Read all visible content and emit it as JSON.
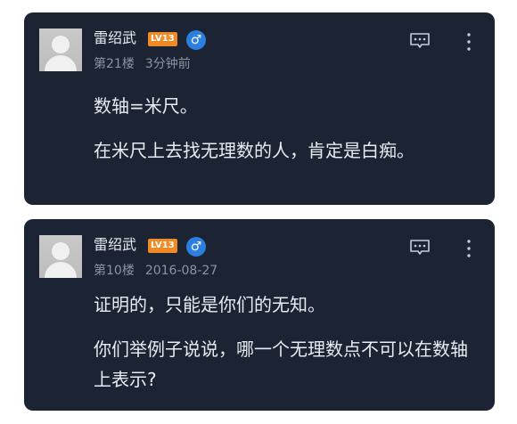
{
  "comments": [
    {
      "username": "雷绍武",
      "level": "LV13",
      "gender": "♂",
      "floor": "第21楼",
      "time": "3分钟前",
      "paragraphs": [
        "数轴=米尺。",
        "在米尺上去找无理数的人，肯定是白痴。"
      ]
    },
    {
      "username": "雷绍武",
      "level": "LV13",
      "gender": "♂",
      "floor": "第10楼",
      "time": "2016-08-27",
      "paragraphs": [
        "证明的，只能是你们的无知。",
        "你们举例子说说，哪一个无理数点不可以在数轴上表示?"
      ]
    }
  ],
  "colors": {
    "card_background": "#1c2333",
    "level_badge": "#f08a24",
    "gender_badge": "#2b7fe0"
  },
  "icons": [
    "comment-icon",
    "more-options-icon",
    "male-icon"
  ]
}
